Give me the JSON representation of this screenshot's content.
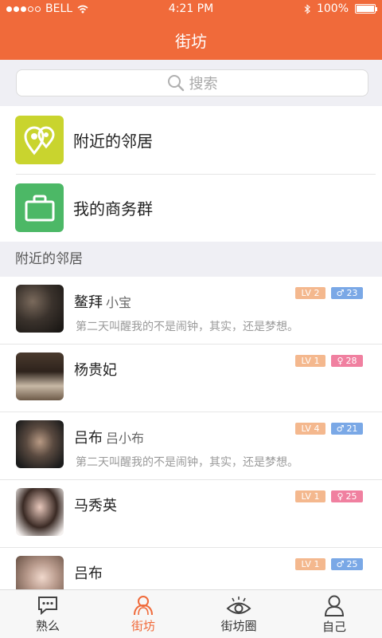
{
  "status_bar": {
    "carrier": "BELL",
    "time": "4:21 PM",
    "battery": "100%",
    "signal_bars": 3,
    "signal_total": 5
  },
  "nav": {
    "title": "街坊"
  },
  "search": {
    "placeholder": "搜索"
  },
  "entries": [
    {
      "label": "附近的邻居",
      "icon": "map-pins-icon",
      "color": "#c9d42e"
    },
    {
      "label": "我的商务群",
      "icon": "briefcase-icon",
      "color": "#4cb866"
    }
  ],
  "section": {
    "title": "附近的邻居"
  },
  "neighbors": [
    {
      "name": "鳌拜",
      "nickname": "小宝",
      "signature": "第二天叫醒我的不是闹钟，其实，还是梦想。",
      "level": "LV 2",
      "gender": "male",
      "age": "23"
    },
    {
      "name": "杨贵妃",
      "nickname": "",
      "signature": "",
      "level": "LV 1",
      "gender": "female",
      "age": "28"
    },
    {
      "name": "吕布",
      "nickname": "吕小布",
      "signature": "第二天叫醒我的不是闹钟，其实，还是梦想。",
      "level": "LV 4",
      "gender": "male",
      "age": "21"
    },
    {
      "name": "马秀英",
      "nickname": "",
      "signature": "",
      "level": "LV 1",
      "gender": "female",
      "age": "25"
    },
    {
      "name": "吕布",
      "nickname": "",
      "signature": "",
      "level": "LV 1",
      "gender": "male",
      "age": "25"
    }
  ],
  "tabs": [
    {
      "label": "熟么",
      "icon": "chat-bubble-icon",
      "active": false
    },
    {
      "label": "街坊",
      "icon": "neighbors-icon",
      "active": true
    },
    {
      "label": "街坊圈",
      "icon": "eye-icon",
      "active": false
    },
    {
      "label": "自己",
      "icon": "person-icon",
      "active": false
    }
  ],
  "colors": {
    "accent": "#f06a3a",
    "male": "#7aa8e6",
    "female": "#f080a0",
    "level": "#f4b88e"
  }
}
